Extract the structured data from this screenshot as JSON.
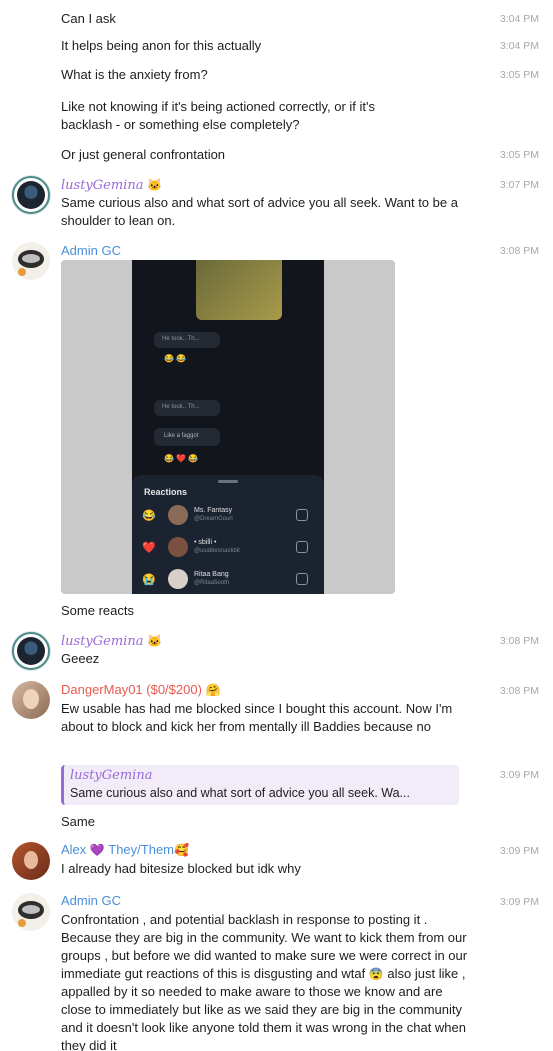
{
  "messages": [
    {
      "text": "Can I ask",
      "time": "3:04 PM"
    },
    {
      "text": "It helps being anon for this actually",
      "time": "3:04 PM"
    },
    {
      "text": "What is the anxiety from?",
      "time": "3:05 PM"
    },
    {
      "text": "Like not knowing if it's being actioned correctly, or if it's backlash - or something else completely?",
      "time": ""
    },
    {
      "text": "Or just general confrontation",
      "time": "3:05 PM"
    },
    {
      "sender": "lustyGemina",
      "sender_emoji": "🐱",
      "text": "Same curious also and what sort of advice you all seek. Want to be a shoulder to lean on.",
      "time": "3:07 PM"
    },
    {
      "sender": "Admin GC",
      "time": "3:08 PM",
      "caption": "Some reacts"
    },
    {
      "sender": "lustyGemina",
      "sender_emoji": "🐱",
      "text": "Geeez",
      "time": "3:08 PM"
    },
    {
      "sender": "DangerMay01 ($0/$200)",
      "sender_emoji": "🤗",
      "text": "Ew usable has had me blocked since I bought this account. Now I'm about to block and kick her from mentally ill Baddies because no",
      "time": "3:08 PM"
    },
    {
      "reply_to_sender": "lustyGemina",
      "reply_to_text": "Same curious also and what sort of advice you all seek. Wa...",
      "text": "Same",
      "time": "3:09 PM"
    },
    {
      "sender": "Alex",
      "sender_heart": "💜",
      "sender_pronouns": "They/Them",
      "sender_emoji": "🥰",
      "text": "I already had bitesize blocked but idk why",
      "time": "3:09 PM"
    },
    {
      "sender": "Admin GC",
      "text_a": "Confrontation , and potential backlash in response to posting it . Because they are big in the community. We want to kick them from our groups , but before we did wanted to make sure we were correct in our immediate gut reactions of this is disgusting and wtaf",
      "text_emoji": "😨",
      "text_b": "also just like , appalled by it so needed to make aware to those we know and are close to immediately but like as we said they are big in the community and it doesn't look like anyone told them it was wrong in the chat when they did it",
      "time": "3:09 PM"
    }
  ],
  "screenshot": {
    "reactions_title": "Reactions",
    "bubble_1": "He took.. Th...",
    "bubble_2": "He took.. Th...",
    "bubble_3": "Like a faggot",
    "rows": [
      {
        "emoji": "😂",
        "name": "Ms. Fantasy",
        "sub": "@DreamGourl"
      },
      {
        "emoji": "❤️",
        "name": "• sbilli •",
        "sub": "@usablesnackbit"
      },
      {
        "emoji": "😭",
        "name": "Ritaa Bang",
        "sub": "@Ritaa5ooth"
      }
    ]
  }
}
